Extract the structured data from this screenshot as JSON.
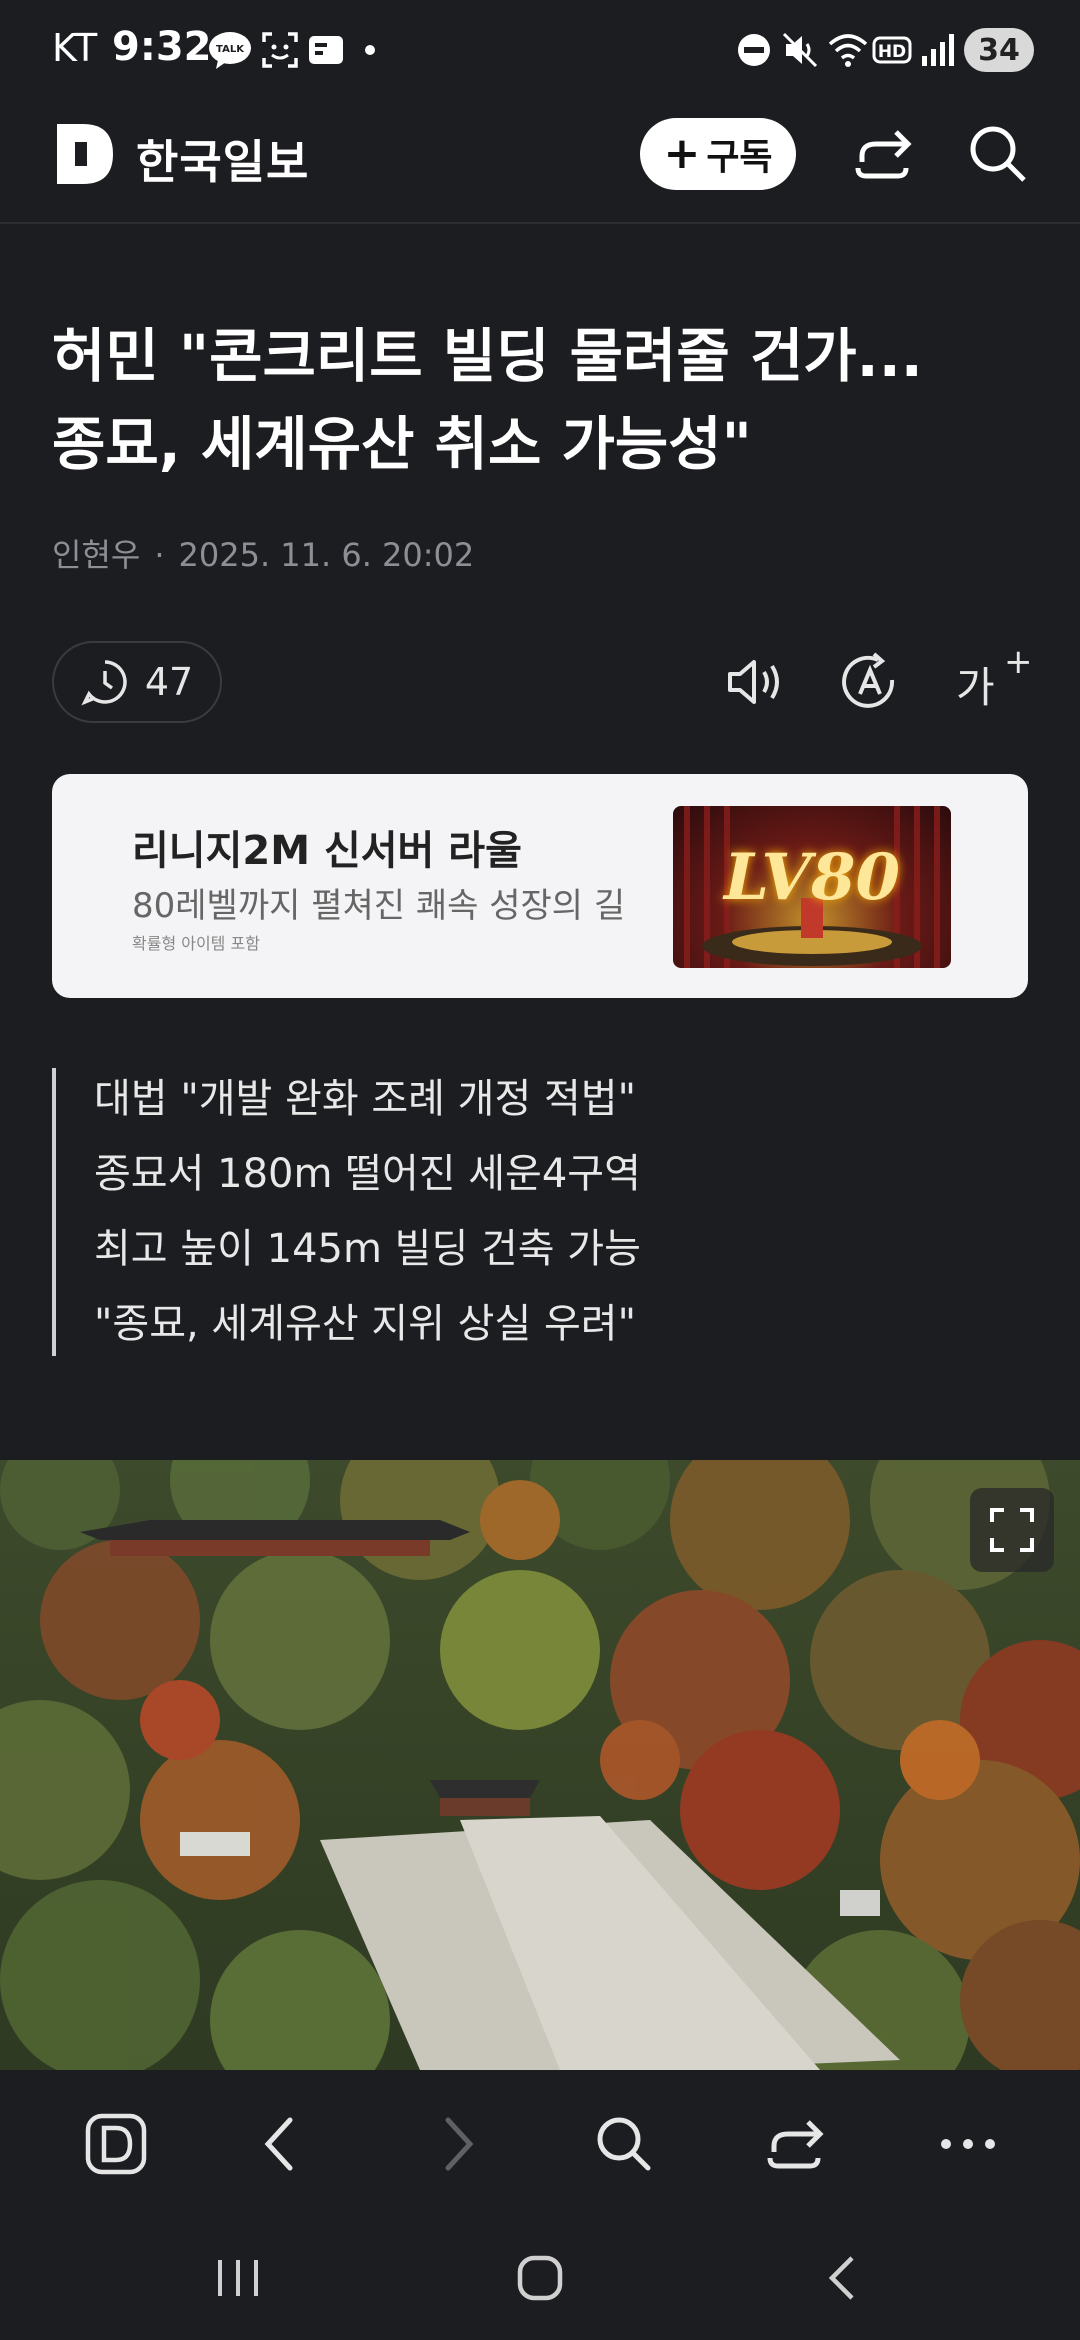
{
  "status_bar": {
    "carrier": "KT",
    "time": "9:32",
    "talk_badge": "TALK",
    "hd_badge": "HD",
    "battery": "34"
  },
  "header": {
    "logo_text": "한국일보",
    "subscribe_label": "구독"
  },
  "article": {
    "headline_line1": "허민 \"콘크리트 빌딩 물려줄 건가...",
    "headline_line2": "종묘, 세계유산 취소 가능성\"",
    "author": "인현우",
    "date": "2025. 11. 6. 20:02",
    "comment_count": "47",
    "font_size_label": "가"
  },
  "ad": {
    "title": "리니지2M 신서버 라울",
    "subtitle": "80레벨까지 펼쳐진 쾌속 성장의 길",
    "note": "확률형 아이템 포함",
    "image_text": "LV80"
  },
  "summary": [
    "대법 \"개발 완화 조례 개정 적법\"",
    "종묘서 180m 떨어진 세운4구역",
    "최고 높이 145m 빌딩 건축 가능",
    "\"종묘, 세계유산 지위 상실 우려\""
  ],
  "icons": {
    "status": [
      "kakaotalk-icon",
      "screenshot-icon",
      "notification-card-icon",
      "dnd-icon",
      "mute-icon",
      "wifi-icon",
      "signal-icon"
    ],
    "header": [
      "share-icon",
      "search-icon"
    ],
    "tools": [
      "comment-clock-icon",
      "speaker-icon",
      "translate-icon",
      "font-size-icon"
    ],
    "browser": [
      "home-d-icon",
      "back-icon",
      "forward-icon",
      "search-icon",
      "share-icon",
      "more-icon"
    ],
    "nav": [
      "recents-icon",
      "home-icon",
      "back-icon"
    ]
  },
  "colors": {
    "background": "#1c1d21",
    "text": "#ffffff",
    "muted": "#8d8f96",
    "ad_background": "#f4f4f6"
  }
}
